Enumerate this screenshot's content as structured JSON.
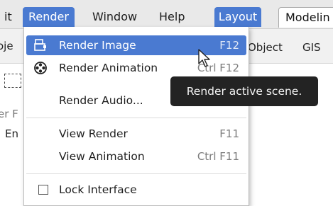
{
  "menubar": {
    "items": [
      "it",
      "Render",
      "Window",
      "Help"
    ],
    "workspaces": [
      "Layout",
      "Modelin"
    ]
  },
  "background": {
    "row2_left": "oje",
    "row2_right": [
      "Object",
      "GIS"
    ],
    "side_labels": [
      "er F",
      "En"
    ]
  },
  "render_menu": {
    "items": [
      {
        "label": "Render Image",
        "shortcut": "F12",
        "icon": "render-image-icon"
      },
      {
        "label": "Render Animation",
        "shortcut": "Ctrl F12",
        "icon": "render-animation-icon"
      },
      {
        "label": "Render Audio...",
        "shortcut": ""
      },
      {
        "label": "View Render",
        "shortcut": "F11"
      },
      {
        "label": "View Animation",
        "shortcut": "Ctrl F11"
      },
      {
        "label": "Lock Interface",
        "shortcut": "",
        "checked": false
      }
    ]
  },
  "tooltip": "Render active scene.",
  "colors": {
    "accent": "#4a7ad1",
    "tooltip_bg": "#232323"
  }
}
